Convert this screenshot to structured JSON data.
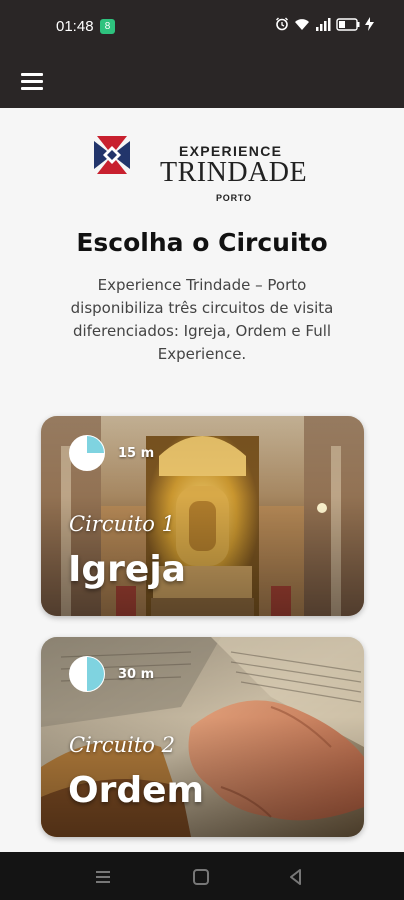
{
  "status_bar": {
    "time": "01:48",
    "badge": "8",
    "icons": [
      "alarm-icon",
      "wifi-icon",
      "signal-icon",
      "battery-icon",
      "charging-icon"
    ]
  },
  "app_bar": {
    "menu_icon": "hamburger-menu-icon"
  },
  "logo": {
    "experience": "EXPERIENCE",
    "trindade": "TRINDADE",
    "porto": "PORTO",
    "colors": {
      "blue": "#22356b",
      "red": "#c8202e"
    }
  },
  "page": {
    "title": "Escolha o Circuito",
    "description": "Experience Trindade – Porto disponibiliza três circuitos de visita diferenciados: Igreja, Ordem e Full Experience."
  },
  "circuits": [
    {
      "subtitle": "Circuito 1",
      "title": "Igreja",
      "duration": "15 m",
      "duration_fraction": 0.25,
      "icon": "clock-icon"
    },
    {
      "subtitle": "Circuito 2",
      "title": "Ordem",
      "duration": "30 m",
      "duration_fraction": 0.5,
      "icon": "clock-icon"
    }
  ],
  "colors": {
    "header_bg": "#2a2626",
    "clock_fill": "#7fd3e0",
    "page_bg": "#f6f6f6"
  },
  "nav_bar": {
    "icons": [
      "recent-apps-icon",
      "home-icon",
      "back-icon"
    ]
  }
}
